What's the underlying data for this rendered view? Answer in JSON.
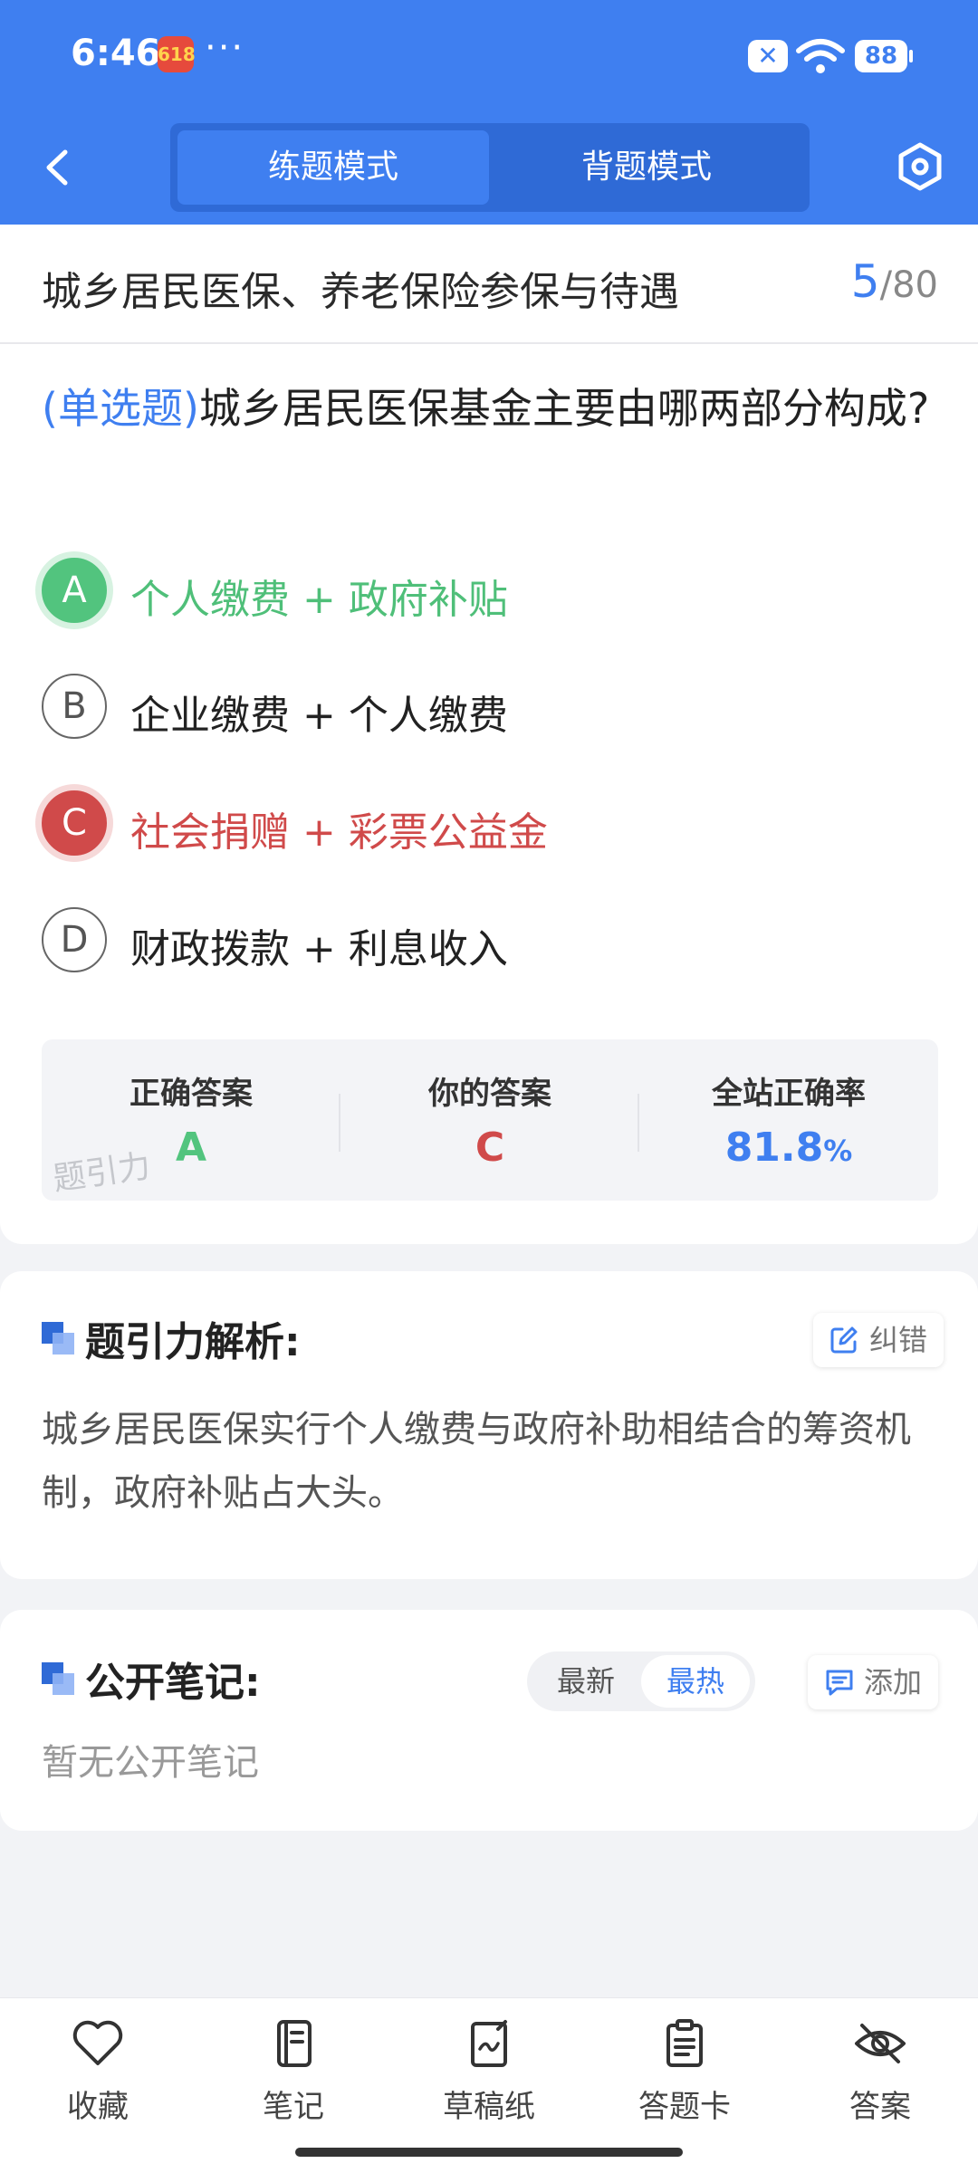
{
  "status_bar": {
    "time": "6:46",
    "app_badge": "618",
    "overflow_dots": "···",
    "battery": "88"
  },
  "header": {
    "tabs": [
      {
        "label": "练题模式",
        "active": true
      },
      {
        "label": "背题模式",
        "active": false
      }
    ]
  },
  "chapter": {
    "title": "城乡居民医保、养老保险参保与待遇",
    "current": "5",
    "separator": "/",
    "total": "80"
  },
  "question": {
    "type_label": "(单选题)",
    "text": "城乡居民医保基金主要由哪两部分构成?",
    "options": [
      {
        "letter": "A",
        "text": "个人缴费 + 政府补贴",
        "state": "correct"
      },
      {
        "letter": "B",
        "text": "企业缴费 + 个人缴费",
        "state": "normal"
      },
      {
        "letter": "C",
        "text": "社会捐赠 + 彩票公益金",
        "state": "wrong"
      },
      {
        "letter": "D",
        "text": "财政拨款 + 利息收入",
        "state": "normal"
      }
    ]
  },
  "stats": {
    "correct_label": "正确答案",
    "correct_value": "A",
    "yours_label": "你的答案",
    "yours_value": "C",
    "rate_label": "全站正确率",
    "rate_value": "81.8",
    "rate_unit": "%",
    "watermark": "题引力"
  },
  "analysis": {
    "title": "题引力解析:",
    "report_label": "纠错",
    "text": "城乡居民医保实行个人缴费与政府补助相结合的筹资机制，政府补贴占大头。"
  },
  "notes": {
    "title": "公开笔记:",
    "sort_newest": "最新",
    "sort_hottest": "最热",
    "add_label": "添加",
    "empty_text": "暂无公开笔记"
  },
  "bottom_nav": [
    {
      "label": "收藏",
      "icon": "heart-icon"
    },
    {
      "label": "笔记",
      "icon": "notebook-icon"
    },
    {
      "label": "草稿纸",
      "icon": "draft-icon"
    },
    {
      "label": "答题卡",
      "icon": "clipboard-icon"
    },
    {
      "label": "答案",
      "icon": "eye-off-icon"
    }
  ],
  "colors": {
    "primary": "#3f7ff0",
    "correct": "#52c47e",
    "wrong": "#d04a4a"
  }
}
